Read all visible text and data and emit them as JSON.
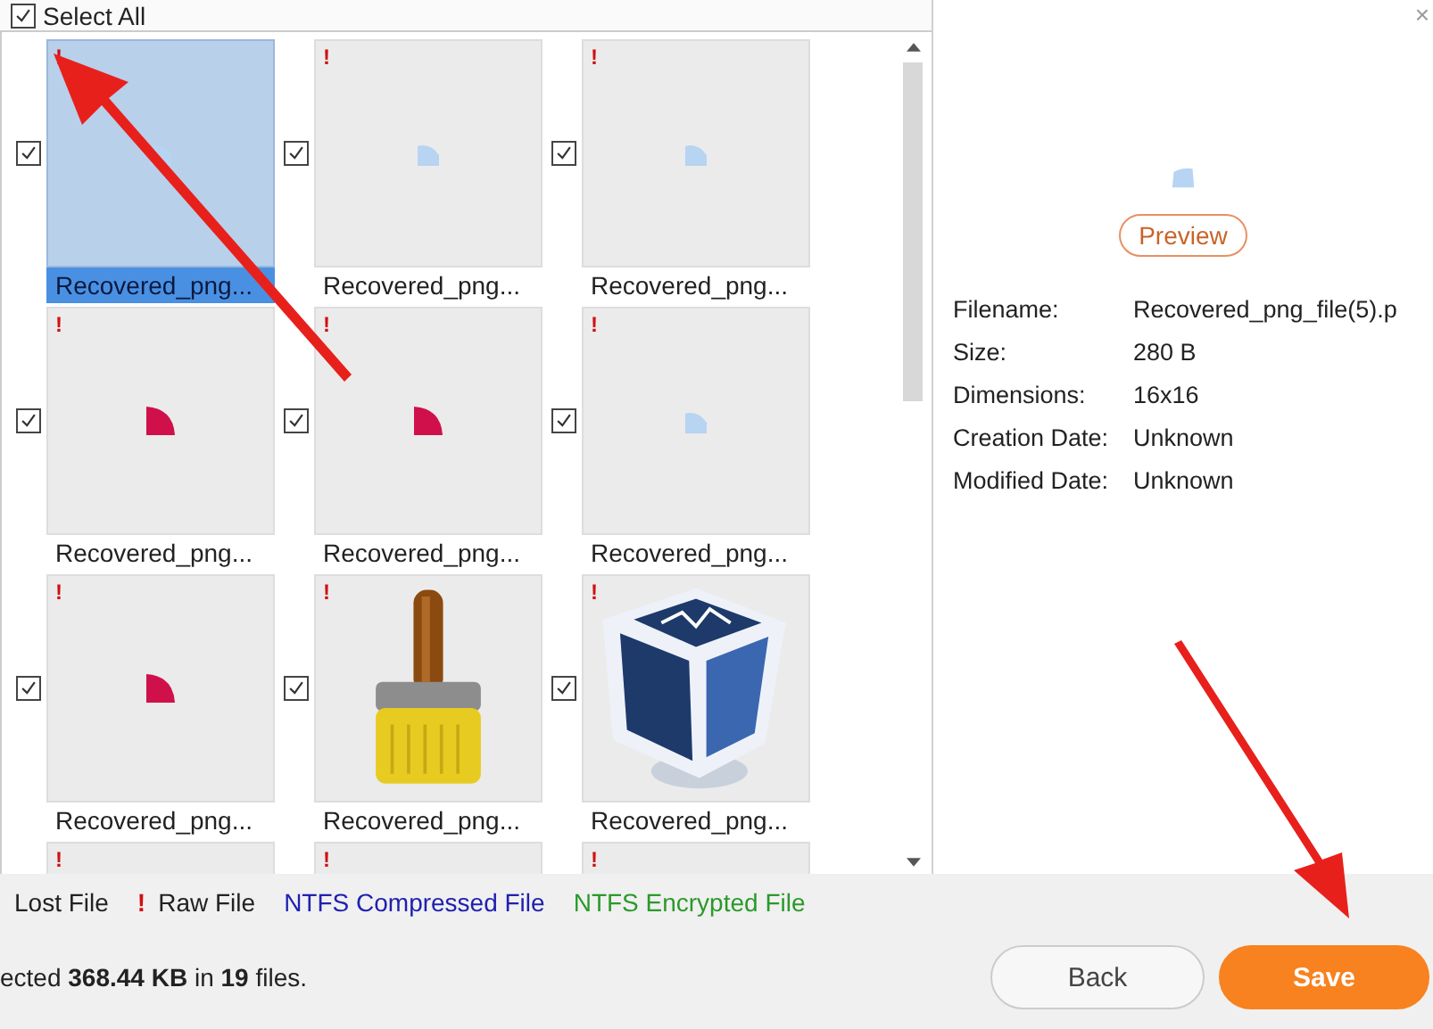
{
  "select_all": {
    "label": "Select All",
    "checked": true
  },
  "tiles": [
    {
      "label": "Recovered_png...",
      "mark": "!",
      "checked": true,
      "selected": true,
      "kind": "light-shape"
    },
    {
      "label": "Recovered_png...",
      "mark": "!",
      "checked": true,
      "selected": false,
      "kind": "light-shape"
    },
    {
      "label": "Recovered_png...",
      "mark": "!",
      "checked": true,
      "selected": false,
      "kind": "light-shape"
    },
    {
      "label": "Recovered_png...",
      "mark": "!",
      "checked": true,
      "selected": false,
      "kind": "red-quarter"
    },
    {
      "label": "Recovered_png...",
      "mark": "!",
      "checked": true,
      "selected": false,
      "kind": "red-quarter"
    },
    {
      "label": "Recovered_png...",
      "mark": "!",
      "checked": true,
      "selected": false,
      "kind": "light-shape"
    },
    {
      "label": "Recovered_png...",
      "mark": "!",
      "checked": true,
      "selected": false,
      "kind": "red-quarter"
    },
    {
      "label": "Recovered_png...",
      "mark": "!",
      "checked": true,
      "selected": false,
      "kind": "brush"
    },
    {
      "label": "Recovered_png...",
      "mark": "!",
      "checked": true,
      "selected": false,
      "kind": "cube"
    },
    {
      "mark": "!",
      "selected": false,
      "kind": "blank"
    },
    {
      "mark": "!",
      "selected": false,
      "kind": "blank"
    },
    {
      "mark": "!",
      "selected": false,
      "kind": "blank"
    }
  ],
  "preview": {
    "button": "Preview",
    "details": [
      {
        "key": "Filename:",
        "value": "Recovered_png_file(5).p"
      },
      {
        "key": "Size:",
        "value": "280 B"
      },
      {
        "key": "Dimensions:",
        "value": "16x16"
      },
      {
        "key": "Creation Date:",
        "value": "Unknown"
      },
      {
        "key": "Modified Date:",
        "value": "Unknown"
      }
    ]
  },
  "close": "×",
  "legend": [
    {
      "label": "Lost File",
      "color": "#222222"
    },
    {
      "mark": "!",
      "label": "Raw File",
      "color": "#222222"
    },
    {
      "label": "NTFS Compressed File",
      "color": "#2020b0"
    },
    {
      "label": "NTFS Encrypted File",
      "color": "#2a9a2a"
    }
  ],
  "status": "ected **368.44 KB** in **19** files.",
  "buttons": [
    {
      "label": "Back",
      "kind": "secondary"
    },
    {
      "label": "Save",
      "kind": "primary"
    }
  ]
}
